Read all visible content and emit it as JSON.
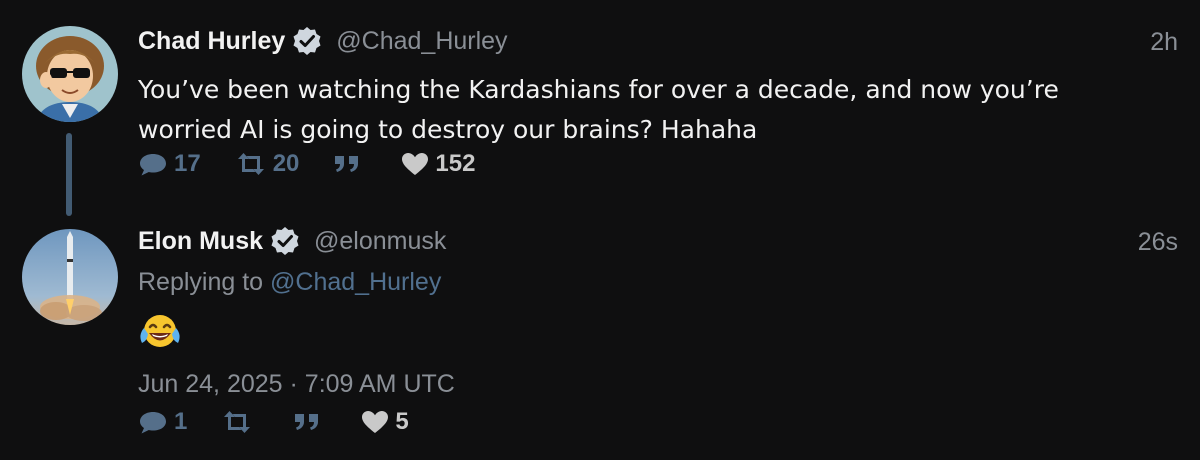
{
  "tweets": [
    {
      "author": {
        "name": "Chad Hurley",
        "handle": "@Chad_Hurley",
        "verified": true,
        "avatar_icon": "cartoon-avatar-sunglasses"
      },
      "time": "2h",
      "text": "You’ve been watching the Kardashians for over a decade, and now you’re worried AI is going to destroy our brains? Hahaha",
      "stats": {
        "replies": "17",
        "retweets": "20",
        "quotes": "",
        "likes": "152"
      }
    },
    {
      "author": {
        "name": "Elon Musk",
        "handle": "@elonmusk",
        "verified": true,
        "avatar_icon": "rocket-launch-avatar"
      },
      "time": "26s",
      "replying_prefix": "Replying to",
      "replying_to": "@Chad_Hurley",
      "emoji_icon": "face-with-tears-of-joy-emoji",
      "date": "Jun 24, 2025 · 7:09 AM UTC",
      "stats": {
        "replies": "1",
        "retweets": "",
        "quotes": "",
        "likes": "5"
      }
    }
  ],
  "colors": {
    "background": "#0f0f10",
    "muted": "#8a8f96",
    "icon": "#556f8a",
    "mention": "#51708f",
    "thread_line": "#425b73"
  }
}
